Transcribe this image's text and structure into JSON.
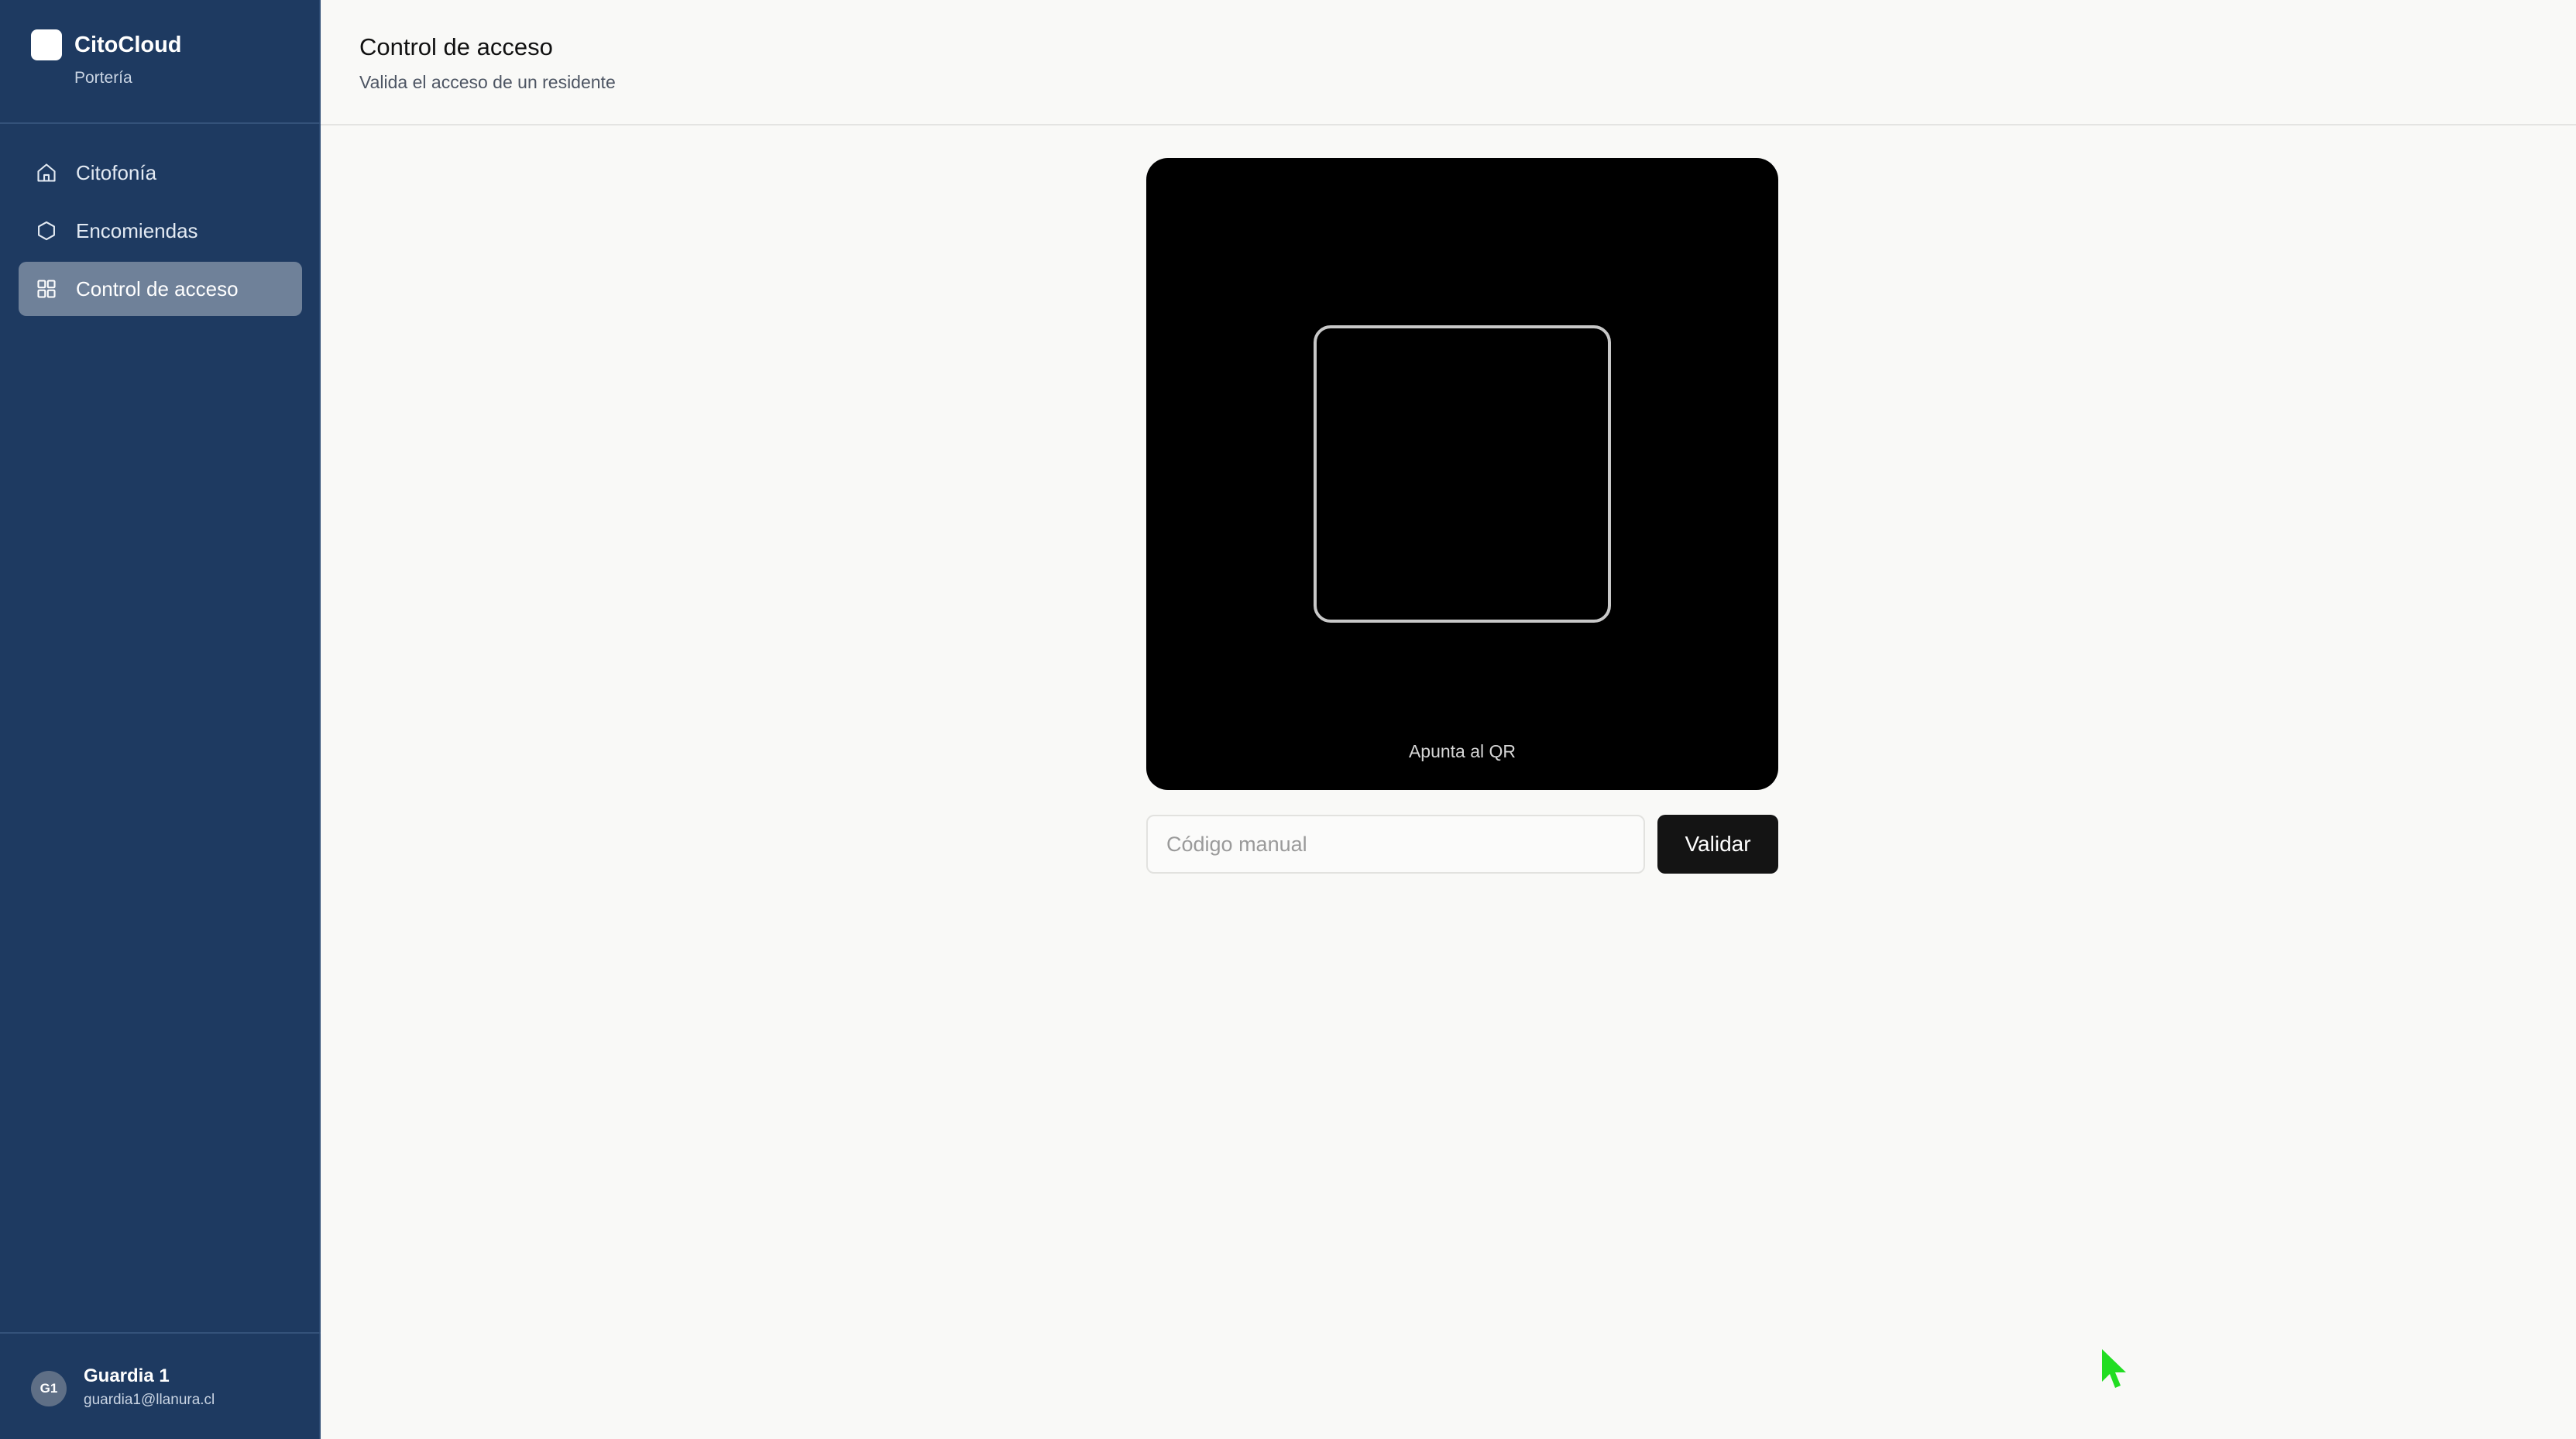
{
  "brand": {
    "name": "CitoCloud",
    "subtitle": "Portería"
  },
  "sidebar": {
    "items": [
      {
        "label": "Citofonía",
        "icon": "home-icon",
        "active": false
      },
      {
        "label": "Encomiendas",
        "icon": "hexagon-icon",
        "active": false
      },
      {
        "label": "Control de acceso",
        "icon": "grid-icon",
        "active": true
      }
    ]
  },
  "user": {
    "initials": "G1",
    "name": "Guardia 1",
    "email": "guardia1@llanura.cl"
  },
  "header": {
    "title": "Control de acceso",
    "subtitle": "Valida el acceso de un residente"
  },
  "scanner": {
    "hint": "Apunta al QR"
  },
  "manual": {
    "placeholder": "Código manual",
    "value": "",
    "button_label": "Validar"
  },
  "colors": {
    "sidebar_bg": "#1e3a61",
    "active_item_bg": "#6f8199",
    "page_bg": "#f9f9f7",
    "button_bg": "#141414",
    "cursor": "#22dd22"
  }
}
